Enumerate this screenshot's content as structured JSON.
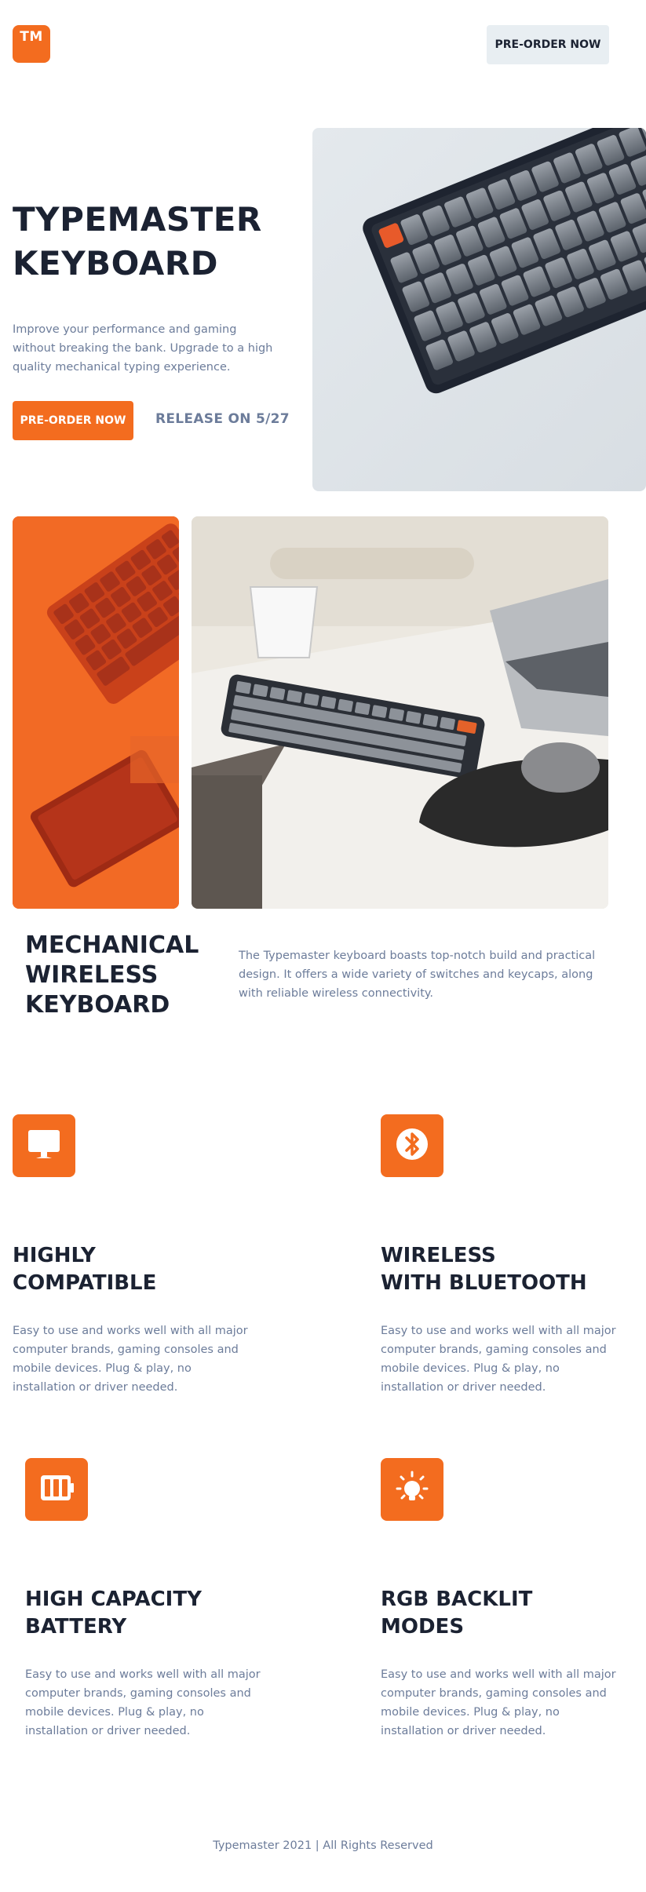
{
  "header": {
    "logo_text": "TM",
    "preorder_label": "PRE-ORDER NOW"
  },
  "hero": {
    "title_line1": "TYPEMASTER",
    "title_line2": "KEYBOARD",
    "description": "Improve your performance and gaming without breaking the bank. Upgrade to a high quality mechanical typing experience.",
    "preorder_label": "PRE-ORDER NOW",
    "release_text": "RELEASE ON 5/27"
  },
  "intro": {
    "title_line1": "MECHANICAL",
    "title_line2": "WIRELESS",
    "title_line3": "KEYBOARD",
    "description": "The Typemaster keyboard boasts top-notch build and practical design. It offers a wide variety of switches and keycaps, along with reliable wireless connectivity."
  },
  "features": [
    {
      "icon": "monitor-icon",
      "title_line1": "HIGHLY",
      "title_line2": "COMPATIBLE",
      "description": "Easy to use and works well with all major computer brands, gaming consoles and mobile devices. Plug & play, no installation or driver needed."
    },
    {
      "icon": "bluetooth-icon",
      "title_line1": "WIRELESS",
      "title_line2": "WITH BLUETOOTH",
      "description": "Easy to use and works well with all major computer brands, gaming consoles and mobile devices. Plug & play, no installation or driver needed."
    },
    {
      "icon": "battery-icon",
      "title_line1": "HIGH CAPACITY",
      "title_line2": "BATTERY",
      "description": "Easy to use and works well with all major computer brands, gaming consoles and mobile devices. Plug & play, no installation or driver needed."
    },
    {
      "icon": "lightbulb-icon",
      "title_line1": "RGB BACKLIT",
      "title_line2": "MODES",
      "description": "Easy to use and works well with all major computer brands, gaming consoles and mobile devices. Plug & play, no installation or driver needed."
    }
  ],
  "footer": {
    "text": "Typemaster 2021 | All Rights Reserved"
  },
  "colors": {
    "accent": "#f36c1f",
    "heading": "#1b2232",
    "body_text": "#6c7c9a",
    "header_button_bg": "#e8eef2"
  }
}
